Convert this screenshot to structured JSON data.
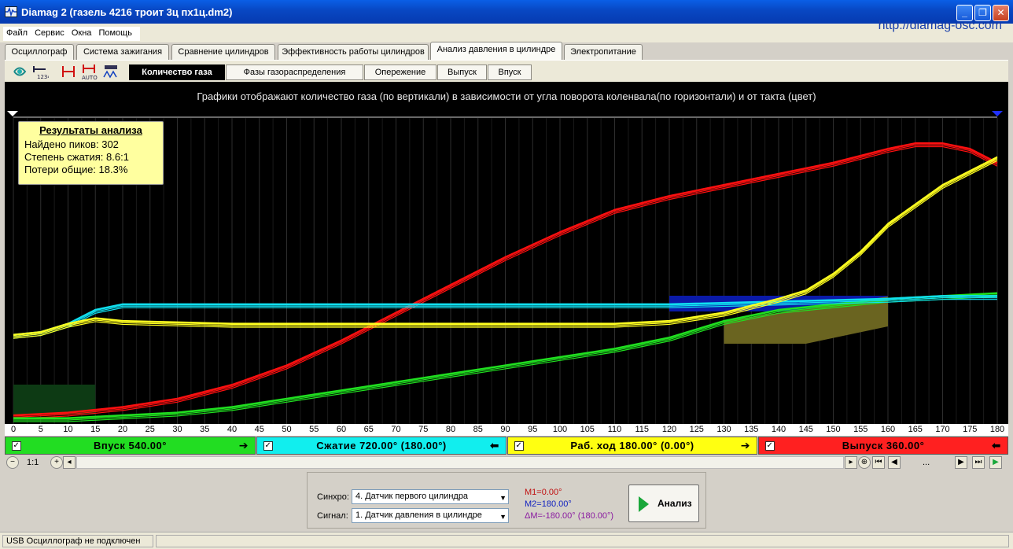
{
  "window": {
    "title": "Diamag 2 (газель 4216 троит 3ц пх1ц.dm2)",
    "url": "http://diamag-osc.com"
  },
  "menu": [
    "Файл",
    "Сервис",
    "Окна",
    "Помощь"
  ],
  "main_tabs": [
    {
      "label": "Осциллограф",
      "active": false
    },
    {
      "label": "Система зажигания",
      "active": false
    },
    {
      "label": "Сравнение цилиндров",
      "active": false
    },
    {
      "label": "Эффективность работы цилиндров",
      "active": false
    },
    {
      "label": "Анализ давления в цилиндре",
      "active": true
    },
    {
      "label": "Электропитание",
      "active": false
    }
  ],
  "toolbar_icons": [
    "sync-icon",
    "numbers-icon",
    "markers-icon",
    "auto-markers-icon",
    "waveform-icon"
  ],
  "sub_tabs": [
    {
      "label": "Количество газа",
      "active": true
    },
    {
      "label": "Фазы газораспределения",
      "active": false
    },
    {
      "label": "Опережение",
      "active": false
    },
    {
      "label": "Выпуск",
      "active": false
    },
    {
      "label": "Впуск",
      "active": false
    }
  ],
  "plot": {
    "caption": "Графики отображают количество газа (по вертикали) в зависимости от угла поворота коленвала(по горизонтали) и от такта (цвет)"
  },
  "results": {
    "title": "Результаты анализа",
    "lines": [
      "Найдено пиков: 302",
      "Степень сжатия: 8.6:1",
      "Потери общие: 18.3%"
    ]
  },
  "chart_data": {
    "type": "line",
    "xlabel": "",
    "ylabel": "",
    "xlim": [
      0,
      180
    ],
    "x_ticks": [
      0,
      5,
      10,
      15,
      20,
      25,
      30,
      35,
      40,
      45,
      50,
      55,
      60,
      65,
      70,
      75,
      80,
      85,
      90,
      95,
      100,
      105,
      110,
      115,
      120,
      125,
      130,
      135,
      140,
      145,
      150,
      155,
      160,
      165,
      170,
      175,
      180
    ],
    "grid": true,
    "series": [
      {
        "color": "#ff1010",
        "x": [
          0,
          10,
          20,
          30,
          40,
          50,
          60,
          70,
          80,
          90,
          100,
          110,
          120,
          130,
          140,
          150,
          160,
          165,
          170,
          175,
          180
        ],
        "y": [
          0.01,
          0.02,
          0.04,
          0.07,
          0.12,
          0.19,
          0.28,
          0.38,
          0.48,
          0.58,
          0.67,
          0.75,
          0.8,
          0.84,
          0.88,
          0.92,
          0.97,
          0.99,
          0.99,
          0.97,
          0.92
        ]
      },
      {
        "color": "#20e020",
        "x": [
          0,
          10,
          20,
          30,
          40,
          50,
          60,
          70,
          80,
          90,
          100,
          110,
          120,
          130,
          140,
          150,
          160,
          170,
          180
        ],
        "y": [
          0.0,
          0.0,
          0.01,
          0.02,
          0.04,
          0.07,
          0.1,
          0.13,
          0.16,
          0.19,
          0.22,
          0.25,
          0.29,
          0.35,
          0.39,
          0.41,
          0.43,
          0.44,
          0.45
        ]
      },
      {
        "color": "#10e0f0",
        "x": [
          0,
          5,
          10,
          15,
          20,
          40,
          60,
          80,
          100,
          120,
          140,
          160,
          170,
          180
        ],
        "y": [
          0.3,
          0.31,
          0.34,
          0.39,
          0.41,
          0.41,
          0.41,
          0.41,
          0.41,
          0.41,
          0.42,
          0.43,
          0.44,
          0.44
        ]
      },
      {
        "color": "#ffff20",
        "x": [
          0,
          5,
          10,
          15,
          20,
          40,
          60,
          80,
          100,
          110,
          120,
          130,
          140,
          145,
          150,
          155,
          160,
          165,
          170,
          175,
          180
        ],
        "y": [
          0.3,
          0.31,
          0.34,
          0.36,
          0.35,
          0.34,
          0.34,
          0.34,
          0.34,
          0.34,
          0.35,
          0.38,
          0.43,
          0.46,
          0.52,
          0.6,
          0.7,
          0.77,
          0.84,
          0.89,
          0.94
        ]
      }
    ]
  },
  "phases": [
    {
      "label": "Впуск 540.00°",
      "color": "#22dd22",
      "arrow": "🡒"
    },
    {
      "label": "Сжатие 720.00° (180.00°)",
      "color": "#11eeee",
      "arrow": "🡐"
    },
    {
      "label": "Раб. ход 180.00° (0.00°)",
      "color": "#ffff11",
      "arrow": "🡒"
    },
    {
      "label": "Выпуск 360.00°",
      "color": "#ff2020",
      "arrow": "🡐"
    }
  ],
  "zoom": {
    "label": "1:1"
  },
  "nav": {
    "ellipsis": "..."
  },
  "controls": {
    "sync_label": "Синхро:",
    "sync_value": "4. Датчик первого цилиндра",
    "signal_label": "Сигнал:",
    "signal_value": "1. Датчик давления в цилиндре",
    "m1": "M1=0.00°",
    "m2": "M2=180.00°",
    "dm": "ΔM=-180.00° (180.00°)",
    "analyze_label": "Анализ"
  },
  "status": {
    "text": "USB Осциллограф не подключен"
  }
}
